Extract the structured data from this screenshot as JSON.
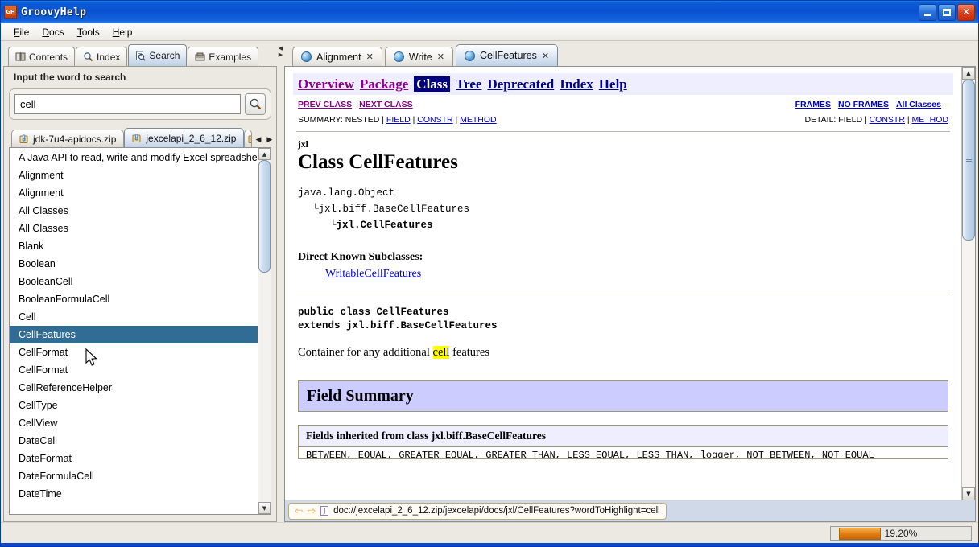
{
  "window": {
    "title": "GroovyHelp",
    "icon": "app-icon",
    "controls": {
      "minimize": "_",
      "maximize": "□",
      "close": "✕"
    }
  },
  "menubar": {
    "items": [
      {
        "label": "File",
        "mnemonic": "F"
      },
      {
        "label": "Docs",
        "mnemonic": "D"
      },
      {
        "label": "Tools",
        "mnemonic": "T"
      },
      {
        "label": "Help",
        "mnemonic": "H"
      }
    ]
  },
  "left_panel": {
    "tabs": [
      {
        "label": "Contents",
        "icon": "book-icon",
        "active": false
      },
      {
        "label": "Index",
        "icon": "magnifier-icon",
        "active": false
      },
      {
        "label": "Search",
        "icon": "search-doc-icon",
        "active": true
      },
      {
        "label": "Examples",
        "icon": "examples-icon",
        "active": false
      }
    ],
    "search": {
      "label": "Input the word to search",
      "value": "cell",
      "placeholder": "",
      "button_icon": "magnifier-icon"
    },
    "zip_tabs": [
      {
        "label": "jdk-7u4-apidocs.zip",
        "icon": "zip-icon",
        "active": false
      },
      {
        "label": "jexcelapi_2_6_12.zip",
        "icon": "zip-icon",
        "active": true
      },
      {
        "label": "",
        "icon": "zip-icon",
        "active": false,
        "partial": true
      }
    ],
    "zip_tab_scroll": {
      "left": "◀",
      "right": "▶"
    },
    "results": [
      {
        "label": "A Java API to read, write and modify Excel spreadsheets",
        "selected": false
      },
      {
        "label": "Alignment",
        "selected": false
      },
      {
        "label": "Alignment",
        "selected": false
      },
      {
        "label": "All Classes",
        "selected": false
      },
      {
        "label": "All Classes",
        "selected": false
      },
      {
        "label": "Blank",
        "selected": false
      },
      {
        "label": "Boolean",
        "selected": false
      },
      {
        "label": "BooleanCell",
        "selected": false
      },
      {
        "label": "BooleanFormulaCell",
        "selected": false
      },
      {
        "label": "Cell",
        "selected": false
      },
      {
        "label": "CellFeatures",
        "selected": true
      },
      {
        "label": "CellFormat",
        "selected": false
      },
      {
        "label": "CellFormat",
        "selected": false
      },
      {
        "label": "CellReferenceHelper",
        "selected": false
      },
      {
        "label": "CellType",
        "selected": false
      },
      {
        "label": "CellView",
        "selected": false
      },
      {
        "label": "DateCell",
        "selected": false
      },
      {
        "label": "DateFormat",
        "selected": false
      },
      {
        "label": "DateFormulaCell",
        "selected": false
      },
      {
        "label": "DateTime",
        "selected": false
      }
    ]
  },
  "right_panel": {
    "doc_tabs": [
      {
        "label": "Alignment",
        "icon": "globe-icon",
        "close": "✕",
        "active": false
      },
      {
        "label": "Write",
        "icon": "globe-icon",
        "close": "✕",
        "active": false
      },
      {
        "label": "CellFeatures",
        "icon": "globe-icon",
        "close": "✕",
        "active": true
      }
    ],
    "document": {
      "nav_links": [
        {
          "label": "Overview",
          "state": "visited"
        },
        {
          "label": "Package",
          "state": "visited"
        },
        {
          "label": "Class",
          "state": "current"
        },
        {
          "label": "Tree",
          "state": "link"
        },
        {
          "label": "Deprecated",
          "state": "link"
        },
        {
          "label": "Index",
          "state": "link"
        },
        {
          "label": "Help",
          "state": "link"
        }
      ],
      "prev_class": "PREV CLASS",
      "next_class": "NEXT CLASS",
      "frames": "FRAMES",
      "no_frames": "NO FRAMES",
      "all_classes": "All Classes",
      "summary_label": "SUMMARY:",
      "summary_items": [
        "NESTED",
        "FIELD",
        "CONSTR",
        "METHOD"
      ],
      "detail_label": "DETAIL:",
      "detail_items": [
        "FIELD",
        "CONSTR",
        "METHOD"
      ],
      "package": "jxl",
      "class_title": "Class CellFeatures",
      "hierarchy": [
        "java.lang.Object",
        "jxl.biff.BaseCellFeatures",
        "jxl.CellFeatures"
      ],
      "subclasses_label": "Direct Known Subclasses:",
      "subclasses": [
        "WritableCellFeatures"
      ],
      "declaration_line1": "public class CellFeatures",
      "declaration_line2": "extends jxl.biff.BaseCellFeatures",
      "description_before": "Container for any additional ",
      "description_highlight": "cell",
      "description_after": " features",
      "field_summary_title": "Field Summary",
      "inherited_title": "Fields inherited from class jxl.biff.BaseCellFeatures",
      "inherited_fields": "BETWEEN, EQUAL, GREATER_EQUAL, GREATER_THAN, LESS_EQUAL, LESS_THAN, logger, NOT_BETWEEN, NOT_EQUAL"
    },
    "url_bar": {
      "back_icon": "back-arrow-icon",
      "forward_icon": "forward-arrow-icon",
      "doc_icon": "javadoc-icon",
      "url": "doc://jexcelapi_2_6_12.zip/jexcelapi/docs/jxl/CellFeatures?wordToHighlight=cell"
    }
  },
  "status_bar": {
    "progress_text": "19.20%",
    "progress_percent": 19.2
  },
  "colors": {
    "title_blue": "#0a4fd0",
    "selection_blue": "#316c94",
    "highlight_yellow": "#ffff00",
    "section_lavender": "#ccccff",
    "subsection_lavender": "#eeeeff",
    "progress_orange": "#e07b10",
    "link_blue": "#0000cd",
    "visited_purple": "#8b008b",
    "current_navy": "#00007f"
  }
}
